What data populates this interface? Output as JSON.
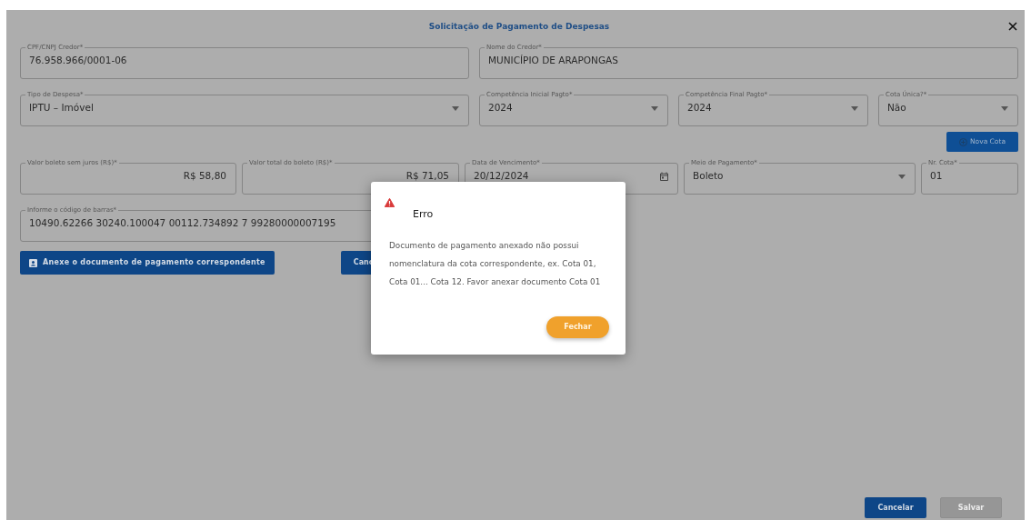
{
  "dialog": {
    "title": "Solicitação de Pagamento de Despesas"
  },
  "form_rows": [
    [
      {
        "kind": "text",
        "label": "CPF/CNPJ Credor*",
        "value": "76.958.966/0001-06"
      },
      {
        "kind": "text",
        "label": "Nome do Credor*",
        "value": "MUNICÍPIO DE ARAPONGAS"
      }
    ],
    [
      {
        "kind": "select",
        "label": "Tipo de Despesa*",
        "value": "IPTU – Imóvel"
      },
      {
        "kind": "select",
        "label": "Competência Inicial Pagto*",
        "value": "2024"
      },
      {
        "kind": "select",
        "label": "Competência Final Pagto*",
        "value": "2024"
      },
      {
        "kind": "select",
        "label": "Cota Única?*",
        "value": "Não"
      }
    ],
    [
      {
        "kind": "money",
        "label": "Valor boleto sem juros (R$)*",
        "value": "R$ 58,80"
      },
      {
        "kind": "money",
        "label": "Valor total do boleto (R$)*",
        "value": "R$ 71,05"
      },
      {
        "kind": "date",
        "label": "Data de Vencimento*",
        "value": "20/12/2024"
      },
      {
        "kind": "select",
        "label": "Meio de Pagamento*",
        "value": "Boleto"
      },
      {
        "kind": "text",
        "label": "Nr. Cota*",
        "value": "01"
      }
    ],
    [
      {
        "kind": "text",
        "label": "Informe o código de barras*",
        "value": "10490.62266 30240.100047 00112.734892 7 99280000007195"
      }
    ]
  ],
  "new_quota_button": {
    "label": "Nova Cota",
    "disabled": true
  },
  "attach_button": {
    "label": "Anexe o documento de pagamento correspondente"
  },
  "cancel_attach_button": {
    "label": "Canc"
  },
  "footer_buttons": [
    {
      "label": "Cancelar",
      "disabled": false
    },
    {
      "label": "Salvar",
      "disabled": true
    }
  ],
  "error_dialog": {
    "title": "Erro",
    "message": "Documento de pagamento anexado não possui nomenclatura da cota correspondente, ex. Cota 01, Cota 01... Cota 12. Favor anexar documento Cota 01",
    "button": "Fechar"
  }
}
